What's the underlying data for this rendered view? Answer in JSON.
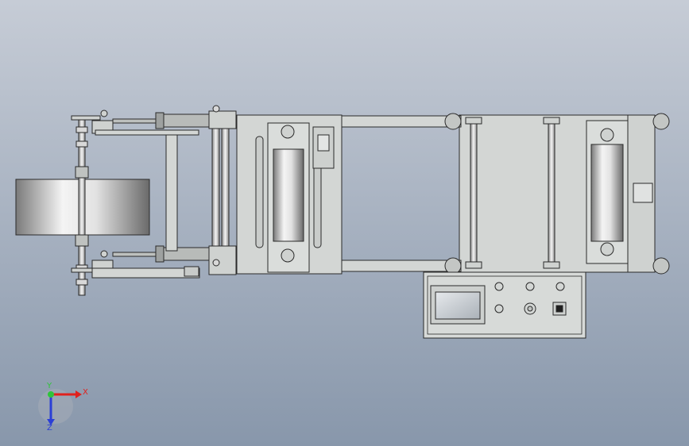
{
  "viewport": {
    "background_top": "#c6ccd6",
    "background_bottom": "#8897ab"
  },
  "triad": {
    "x_label": "X",
    "y_label": "Y",
    "z_label": "Z",
    "x_color": "#e0211d",
    "y_color": "#2ec43a",
    "z_color": "#2b3fd6"
  },
  "model": {
    "frame_fill": "#d3d6d4",
    "edge_color": "#2a2a2a",
    "roller_light": "#f2f2f2",
    "roller_dark": "#6e6e6e",
    "screen_color": "#c9ced4"
  }
}
